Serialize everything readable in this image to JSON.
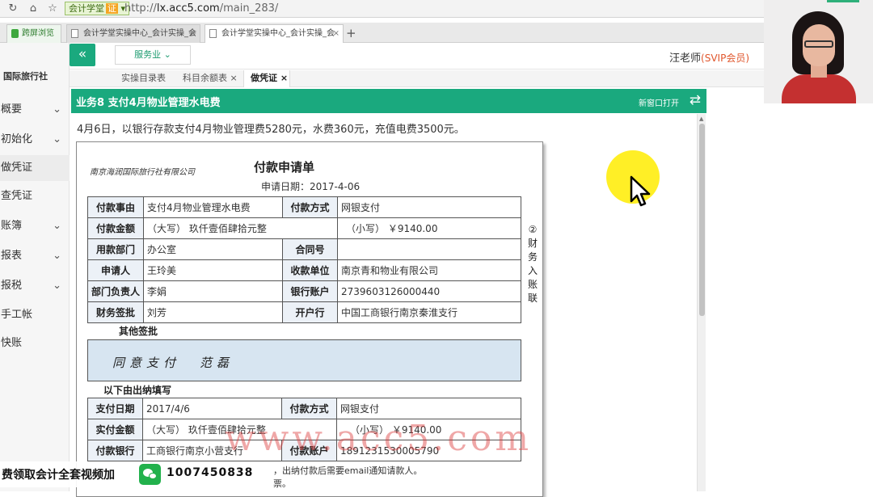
{
  "browser": {
    "site_label": "会计学堂",
    "site_cert": "证",
    "url_prefix": "http://",
    "url_domain": "lx.acc5.com",
    "url_path": "/main_283/",
    "tabs": [
      {
        "label": "跨屏浏览"
      },
      {
        "label": "会计学堂实操中心_会计实操_会"
      },
      {
        "label": "会计学堂实操中心_会计实操_会"
      }
    ],
    "close_glyph": "×",
    "new_tab_glyph": "+"
  },
  "header": {
    "collapse_glyph": "«",
    "industry": "服务业",
    "user": "汪老师",
    "membership": "(SVIP会员)"
  },
  "sidebar": {
    "company": "国际旅行社",
    "items": [
      {
        "label": "概要",
        "chev": "⌄"
      },
      {
        "label": "初始化",
        "chev": "⌄"
      },
      {
        "label": "做凭证",
        "chev": ""
      },
      {
        "label": "查凭证",
        "chev": ""
      },
      {
        "label": "账簿",
        "chev": "⌄"
      },
      {
        "label": "报表",
        "chev": "⌄"
      },
      {
        "label": "报税",
        "chev": "⌄"
      },
      {
        "label": "手工帐",
        "chev": ""
      },
      {
        "label": "快账",
        "chev": ""
      }
    ]
  },
  "work_tabs": [
    {
      "label": "实操目录表"
    },
    {
      "label": "科目余额表"
    },
    {
      "label": "做凭证"
    }
  ],
  "task": {
    "title": "业务8 支付4月物业管理水电费",
    "new_window": "新窗口打开",
    "swap_glyph": "⇄",
    "description": "4月6日，以银行存款支付4月物业管理费5280元，水费360元，充值电费3500元。"
  },
  "voucher": {
    "company": "南京海润国际旅行社有限公司",
    "title": "付款申请单",
    "apply_date": "申请日期：2017-4-06",
    "fields": {
      "reason_label": "付款事由",
      "reason": "支付4月物业管理水电费",
      "method_label": "付款方式",
      "method": "网银支付",
      "amount_label": "付款金额",
      "amount_upper": "（大写） 玖仟壹佰肆拾元整",
      "amount_lower": "（小写） ￥9140.00",
      "dept_label": "用款部门",
      "dept": "办公室",
      "contract_label": "合同号",
      "contract": "",
      "applicant_label": "申请人",
      "applicant": "王玲美",
      "payee_label": "收款单位",
      "payee": "南京青和物业有限公司",
      "head_label": "部门负责人",
      "head": "李娟",
      "account_label": "银行账户",
      "account": "2739603126000440",
      "finance_label": "财务签批",
      "finance": "刘芳",
      "bank_label": "开户行",
      "bank": "中国工商银行南京秦淮支行"
    },
    "other_sign_label": "其他签批",
    "handwriting": "同意支付",
    "signature": "范磊",
    "cashier_label": "以下由出纳填写",
    "cashier": {
      "pay_date_label": "支付日期",
      "pay_date": "2017/4/6",
      "pay_method_label": "付款方式",
      "pay_method": "网银支付",
      "actual_label": "实付金额",
      "actual_upper": "（大写） 玖仟壹佰肆拾元整",
      "actual_lower": "（小写） ￥9140.00",
      "pay_bank_label": "付款银行",
      "pay_bank": "工商银行南京小营支行",
      "pay_account_label": "付款账户",
      "pay_account": "1891231530005790"
    },
    "vertical_note": "②财务入账联",
    "footnote": "，出纳付款后需要email通知请款人。",
    "footnote2": "票。"
  },
  "watermark": "www.acc5.com",
  "promo": {
    "text": "费领取会计全套视频加",
    "number": "1007450838"
  },
  "colors": {
    "accent": "#1aa97e",
    "membership": "#e0562c",
    "label_bg": "#ecf1f7",
    "sign_bg": "#d7e5f1",
    "watermark": "#dc3c3c",
    "highlight": "#ffec00"
  },
  "icons": [
    "refresh-icon",
    "home-icon",
    "star-icon",
    "page-icon",
    "chevron-down-icon",
    "swap-icon",
    "wechat-icon",
    "cursor-icon"
  ]
}
